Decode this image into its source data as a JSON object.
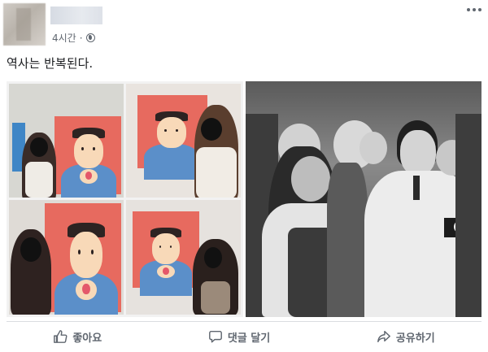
{
  "post": {
    "time": "4시간",
    "time_separator": "·",
    "text": "역사는 반복된다."
  },
  "icons": {
    "privacy": "globe-icon",
    "menu": "more-horizontal-icon",
    "like": "thumbs-up-icon",
    "comment": "speech-bubble-icon",
    "share": "share-arrow-icon"
  },
  "actions": {
    "like": "좋아요",
    "comment": "댓글 달기",
    "share": "공유하기"
  },
  "colors": {
    "meta_text": "#606770",
    "poster_red": "#e76a5f"
  }
}
